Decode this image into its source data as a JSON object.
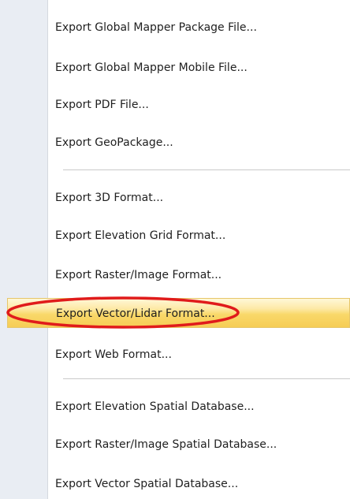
{
  "menu": {
    "items": [
      {
        "label": "Export Global Mapper Package File..."
      },
      {
        "label": "Export Global Mapper Mobile File..."
      },
      {
        "label": "Export PDF File..."
      },
      {
        "label": "Export GeoPackage..."
      },
      {
        "label": "Export 3D Format..."
      },
      {
        "label": "Export Elevation Grid Format..."
      },
      {
        "label": "Export Raster/Image Format..."
      },
      {
        "label": "Export Vector/Lidar Format...",
        "highlighted": true
      },
      {
        "label": "Export Web Format..."
      },
      {
        "label": "Export Elevation Spatial Database..."
      },
      {
        "label": "Export Raster/Image Spatial Database..."
      },
      {
        "label": "Export Vector Spatial Database..."
      }
    ]
  },
  "annotation": {
    "shape": "ellipse",
    "color": "#e01b1b",
    "target": "Export Vector/Lidar Format..."
  },
  "colors": {
    "highlight": "#f9d86a",
    "gutter": "#e9edf3",
    "text": "#1f1f1f"
  }
}
